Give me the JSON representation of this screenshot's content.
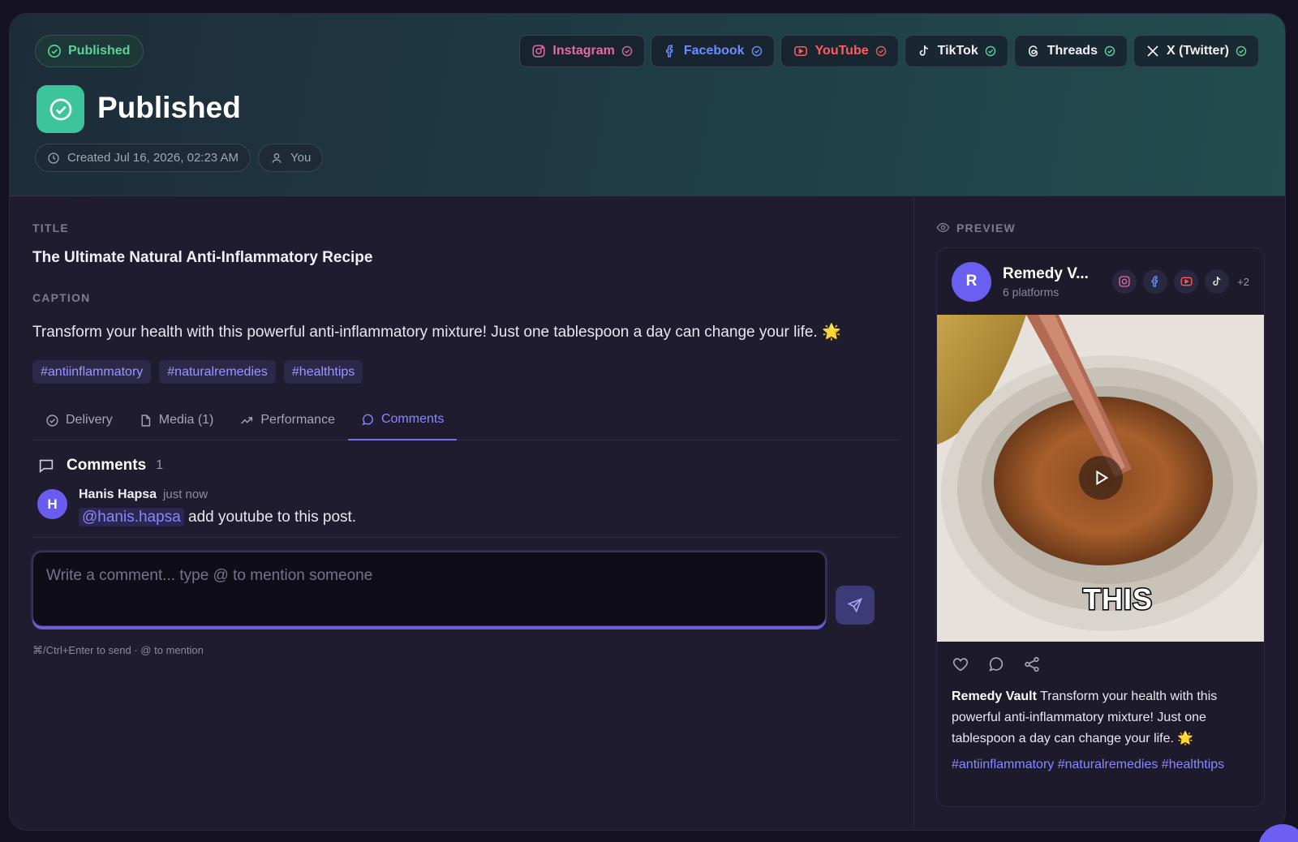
{
  "header": {
    "status_pill": "Published",
    "title": "Published",
    "created": "Created Jul 16, 2026, 02:23 AM",
    "author": "You",
    "platforms": [
      {
        "name": "Instagram",
        "color": "#e46aa7"
      },
      {
        "name": "Facebook",
        "color": "#6f8cff"
      },
      {
        "name": "YouTube",
        "color": "#ff5d5d"
      },
      {
        "name": "TikTok",
        "color": "#f2f2f5"
      },
      {
        "name": "Threads",
        "color": "#f2f2f5"
      },
      {
        "name": "X (Twitter)",
        "color": "#f2f2f5"
      }
    ]
  },
  "post": {
    "title_label": "TITLE",
    "title": "The Ultimate Natural Anti-Inflammatory Recipe",
    "caption_label": "CAPTION",
    "caption": "Transform your health with this powerful anti-inflammatory mixture! Just one tablespoon a day can change your life. 🌟",
    "hashtags": [
      "#antiinflammatory",
      "#naturalremedies",
      "#healthtips"
    ]
  },
  "tabs": [
    {
      "label": "Delivery"
    },
    {
      "label": "Media (1)"
    },
    {
      "label": "Performance"
    },
    {
      "label": "Comments"
    }
  ],
  "comments": {
    "title": "Comments",
    "count": "1",
    "items": [
      {
        "avatar": "H",
        "author": "Hanis Hapsa",
        "time": "just now",
        "mention": "@hanis.hapsa",
        "text": " add youtube to this post."
      }
    ],
    "placeholder": "Write a comment... type @ to mention someone",
    "hint": "⌘/Ctrl+Enter to send · @ to mention"
  },
  "preview": {
    "label": "PREVIEW",
    "avatar": "R",
    "name": "Remedy V...",
    "sub": "6 platforms",
    "more": "+2",
    "overlay_text": "THIS",
    "account": "Remedy Vault",
    "caption": " Transform your health with this powerful anti-inflammatory mixture! Just one tablespoon a day can change your life. 🌟",
    "tags": "#antiinflammatory #naturalremedies #healthtips"
  },
  "colors": {
    "accent": "#7a6df2",
    "success": "#3cc49b"
  }
}
